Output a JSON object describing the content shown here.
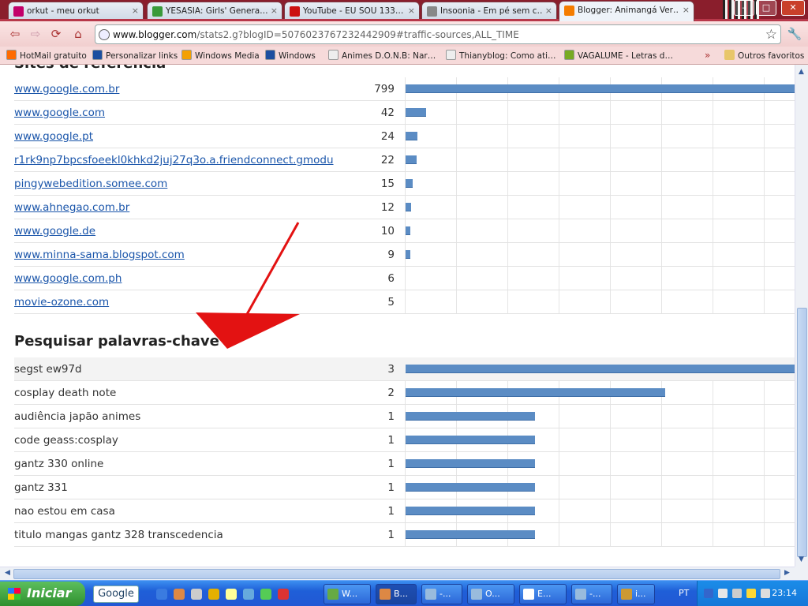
{
  "tabs": [
    {
      "title": "orkut - meu orkut",
      "color": "#c2006a"
    },
    {
      "title": "YESASIA: Girls' Genera…",
      "color": "#3a9a3a"
    },
    {
      "title": "YouTube - EU SOU 133…",
      "color": "#cc1111"
    },
    {
      "title": "Insoonia - Em pé sem c…",
      "color": "#888888"
    },
    {
      "title": "Blogger: Animangá Ver…",
      "color": "#f57d00"
    }
  ],
  "url": {
    "domain": "www.blogger.com",
    "path": "/stats2.g?blogID=5076023767232442909#traffic-sources,ALL_TIME"
  },
  "bookmarks": [
    {
      "label": "HotMail gratuito"
    },
    {
      "label": "Personalizar links"
    },
    {
      "label": "Windows Media"
    },
    {
      "label": "Windows"
    },
    {
      "label": "Animes D.O.N.B: Nar…"
    },
    {
      "label": "Thianyblog: Como ati…"
    },
    {
      "label": "VAGALUME - Letras d…"
    }
  ],
  "bookmarks_more": "»",
  "other_bookmarks": "Outros favoritos",
  "sites_section": {
    "title_partial": "Sites de referência",
    "rows": [
      {
        "label": "www.google.com.br",
        "count": 799
      },
      {
        "label": "www.google.com",
        "count": 42
      },
      {
        "label": "www.google.pt",
        "count": 24
      },
      {
        "label": "r1rk9np7bpcsfoeekl0khkd2juj27q3o.a.friendconnect.gmodu",
        "count": 22
      },
      {
        "label": "pingywebedition.somee.com",
        "count": 15
      },
      {
        "label": "www.ahnegao.com.br",
        "count": 12
      },
      {
        "label": "www.google.de",
        "count": 10
      },
      {
        "label": "www.minna-sama.blogspot.com",
        "count": 9
      },
      {
        "label": "www.google.com.ph",
        "count": 6
      },
      {
        "label": "movie-ozone.com",
        "count": 5
      }
    ]
  },
  "keywords_section": {
    "title": "Pesquisar palavras-chave",
    "rows": [
      {
        "label": "segst ew97d",
        "count": 3
      },
      {
        "label": "cosplay death note",
        "count": 2
      },
      {
        "label": "audiência japão animes",
        "count": 1
      },
      {
        "label": "code geass:cosplay",
        "count": 1
      },
      {
        "label": "gantz 330 online",
        "count": 1
      },
      {
        "label": "gantz 331",
        "count": 1
      },
      {
        "label": "nao estou em casa",
        "count": 1
      },
      {
        "label": "titulo mangas gantz 328 transcedencia",
        "count": 1
      }
    ]
  },
  "taskbar": {
    "start_label": "Iniciar",
    "google_label": "Google",
    "buttons": [
      {
        "label": "W..."
      },
      {
        "label": "B..."
      },
      {
        "label": "-..."
      },
      {
        "label": "O..."
      },
      {
        "label": "E..."
      },
      {
        "label": "-..."
      },
      {
        "label": "i..."
      }
    ],
    "lang": "PT",
    "clock": "23:14"
  }
}
